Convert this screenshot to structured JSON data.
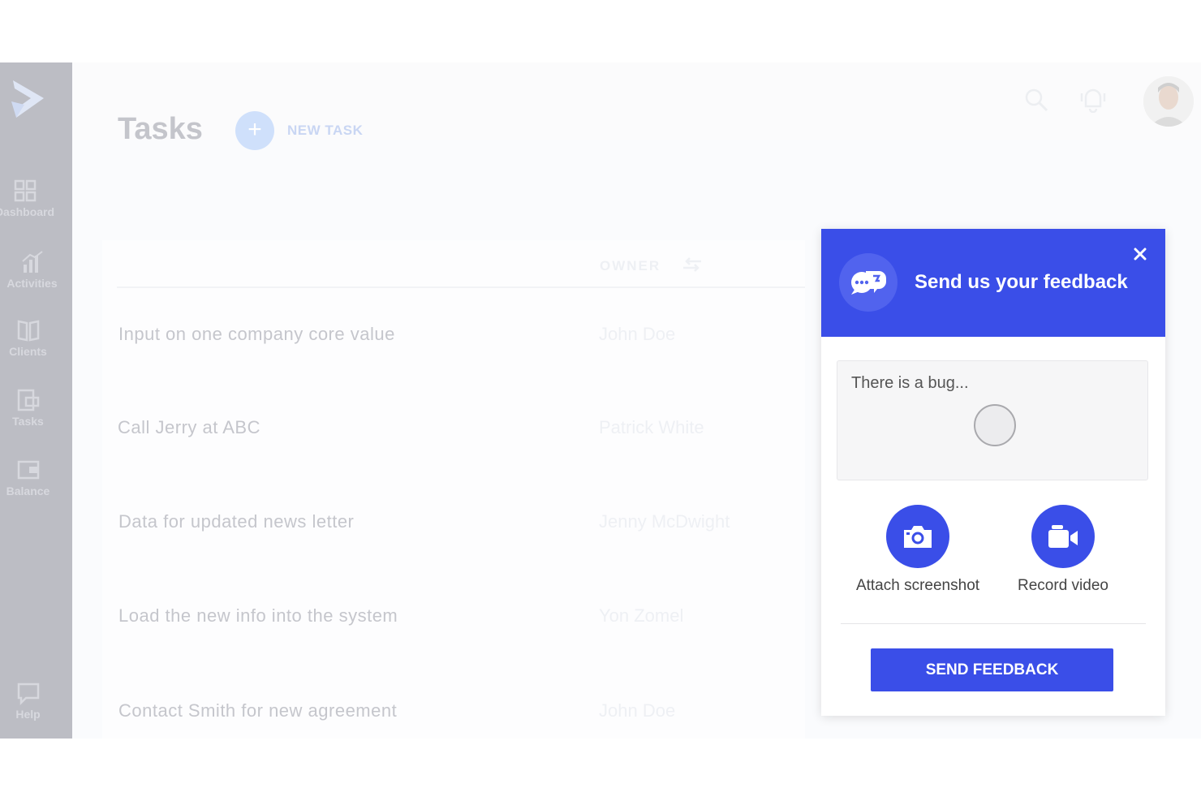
{
  "sidebar": {
    "items": [
      {
        "label": "Dashboard",
        "icon": "dashboard-icon"
      },
      {
        "label": "Activities",
        "icon": "activities-icon"
      },
      {
        "label": "Clients",
        "icon": "clients-icon"
      },
      {
        "label": "Tasks",
        "icon": "tasks-icon"
      },
      {
        "label": "Balance",
        "icon": "balance-icon"
      },
      {
        "label": "Help",
        "icon": "help-icon"
      }
    ]
  },
  "header": {
    "title": "Tasks",
    "new_task_label": "NEW TASK",
    "new_task_icon": "+"
  },
  "table": {
    "owner_header": "OWNER",
    "rows": [
      {
        "task": "Input on one company core value",
        "owner": "John Doe"
      },
      {
        "task": "Call Jerry at ABC",
        "owner": "Patrick White"
      },
      {
        "task": "Data for updated news letter",
        "owner": "Jenny McDwight"
      },
      {
        "task": "Load the new info into the system",
        "owner": "Yon Zomel"
      },
      {
        "task": "Contact Smith for new agreement",
        "owner": "John Doe"
      }
    ]
  },
  "feedback": {
    "title": "Send us your feedback",
    "message_value": "There is a bug...",
    "attach_label": "Attach screenshot",
    "record_label": "Record video",
    "send_label": "SEND FEEDBACK",
    "accent_color": "#3a4ee8"
  }
}
